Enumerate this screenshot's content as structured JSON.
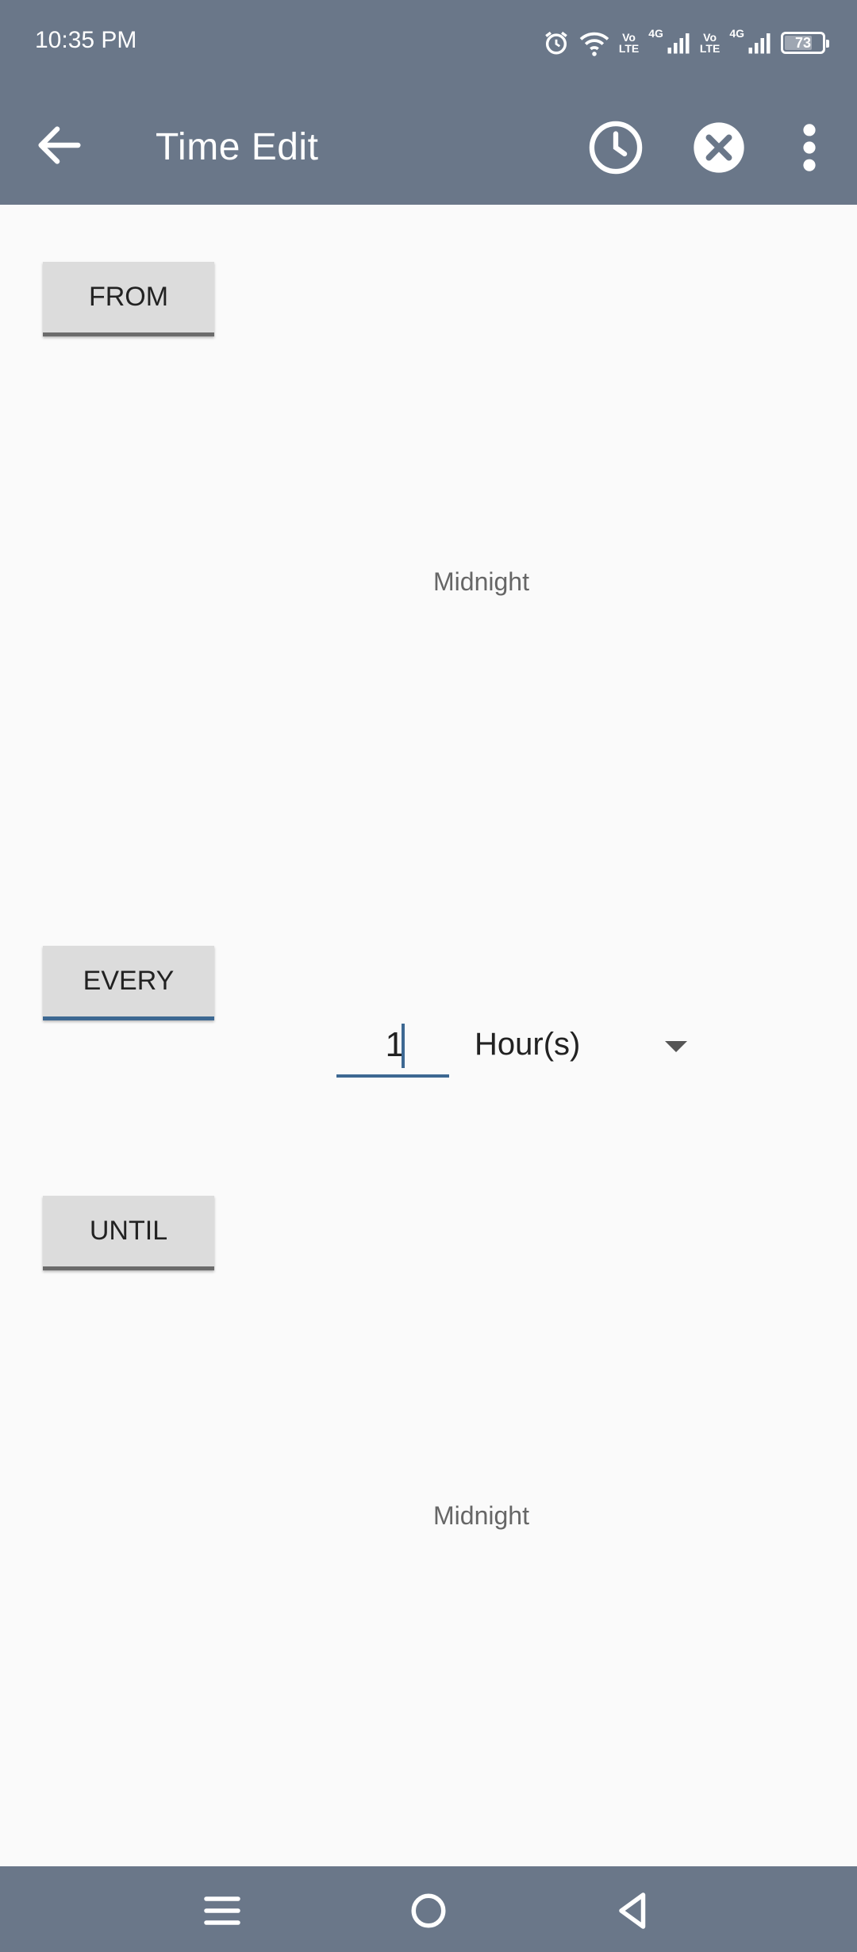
{
  "status_bar": {
    "time": "10:35 PM",
    "volte_1": "Vo\nLTE",
    "net_1": "4G",
    "volte_2": "Vo\nLTE",
    "net_2": "4G",
    "battery_level": "73",
    "battery_fraction": 0.73,
    "icons": [
      "alarm-icon",
      "wifi-icon",
      "signal-icon",
      "signal-icon",
      "battery-icon"
    ]
  },
  "app_bar": {
    "title": "Time Edit",
    "icons": [
      "back-arrow-icon",
      "clock-icon",
      "close-circle-icon",
      "more-vert-icon"
    ]
  },
  "from": {
    "button_label": "FROM",
    "value": "Midnight"
  },
  "every": {
    "button_label": "EVERY",
    "interval_value": "1",
    "unit": "Hour(s)"
  },
  "until": {
    "button_label": "UNTIL",
    "value": "Midnight"
  },
  "nav_bar": {
    "icons": [
      "menu-icon",
      "home-icon",
      "back-icon"
    ]
  },
  "colors": {
    "bar": "#6a7789",
    "accent": "#3d6892",
    "button_bg": "#dcdcdc",
    "background": "#fafafa"
  }
}
